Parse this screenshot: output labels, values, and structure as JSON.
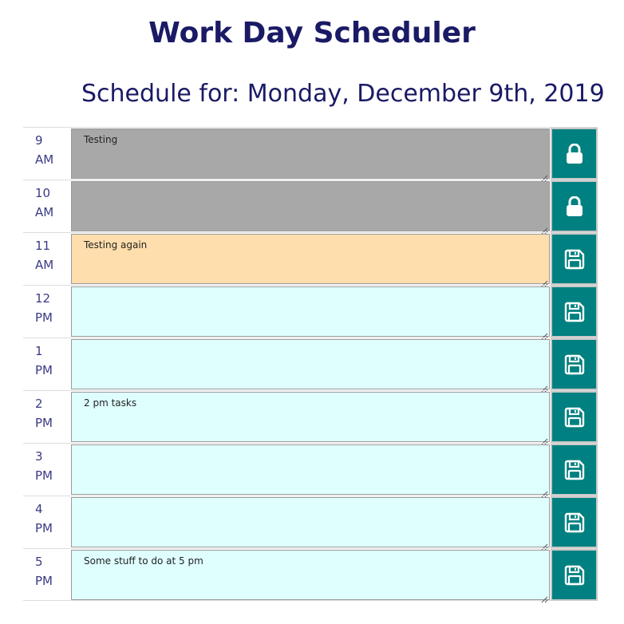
{
  "header": {
    "title": "Work Day Scheduler",
    "date_prefix": "Schedule for:",
    "date": "Monday, December 9th, 2019"
  },
  "colors": {
    "past": "#a8a8a8",
    "present": "#ffdead",
    "future": "#dfffff",
    "button": "#008080",
    "title": "#1a1a66"
  },
  "hours": [
    {
      "hour": "9",
      "period": "AM",
      "text": "Testing",
      "state": "past",
      "icon": "lock-icon"
    },
    {
      "hour": "10",
      "period": "AM",
      "text": "",
      "state": "past",
      "icon": "lock-icon"
    },
    {
      "hour": "11",
      "period": "AM",
      "text": "Testing again",
      "state": "present",
      "icon": "save-icon"
    },
    {
      "hour": "12",
      "period": "PM",
      "text": "",
      "state": "future",
      "icon": "save-icon"
    },
    {
      "hour": "1",
      "period": "PM",
      "text": "",
      "state": "future",
      "icon": "save-icon"
    },
    {
      "hour": "2",
      "period": "PM",
      "text": "2 pm tasks",
      "state": "future",
      "icon": "save-icon"
    },
    {
      "hour": "3",
      "period": "PM",
      "text": "",
      "state": "future",
      "icon": "save-icon"
    },
    {
      "hour": "4",
      "period": "PM",
      "text": "",
      "state": "future",
      "icon": "save-icon"
    },
    {
      "hour": "5",
      "period": "PM",
      "text": "Some stuff to do at 5 pm",
      "state": "future",
      "icon": "save-icon"
    }
  ]
}
